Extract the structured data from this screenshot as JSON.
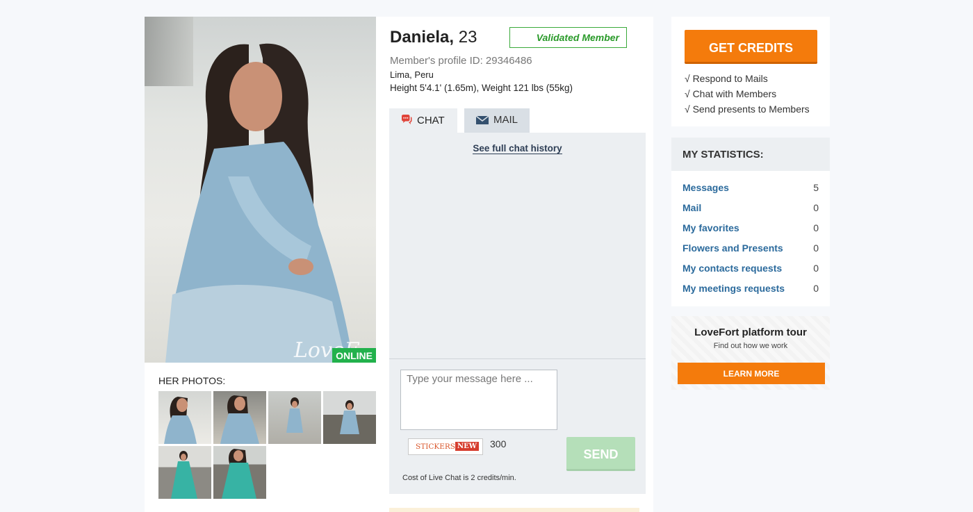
{
  "profile": {
    "name": "Daniela,",
    "age": "23",
    "validated_label": "Validated Member",
    "profile_id": "Member's profile ID: 29346486",
    "location": "Lima, Peru",
    "height_weight": "Height 5'4.1' (1.65m), Weight 121 lbs (55kg)",
    "online_label": "ONLINE",
    "watermark": "LoveF"
  },
  "photos": {
    "title": "HER PHOTOS:"
  },
  "tabs": {
    "chat_label": "CHAT",
    "mail_label": "MAIL"
  },
  "chat": {
    "history_link": "See full chat history",
    "placeholder": "Type your message here ...",
    "stickers_label": "STICKERS",
    "new_badge": "NEW",
    "char_count": "300",
    "send_label": "SEND",
    "cost_note": "Cost of Live Chat is 2 credits/min."
  },
  "credits": {
    "button_label": "GET CREDITS",
    "benefits": [
      "√ Respond to Mails",
      "√ Chat with Members",
      "√ Send presents to Members"
    ]
  },
  "statistics": {
    "title": "MY STATISTICS:",
    "rows": [
      {
        "label": "Messages",
        "value": "5"
      },
      {
        "label": "Mail",
        "value": "0"
      },
      {
        "label": "My favorites",
        "value": "0"
      },
      {
        "label": "Flowers and Presents",
        "value": "0"
      },
      {
        "label": "My contacts requests",
        "value": "0"
      },
      {
        "label": "My meetings requests",
        "value": "0"
      }
    ]
  },
  "tour": {
    "title": "LoveFort platform tour",
    "subtitle": "Find out how we work",
    "button_label": "LEARN MORE"
  },
  "colors": {
    "accent_orange": "#f47b0c",
    "online_green": "#22b14c",
    "link_blue": "#2b6a9c",
    "send_disabled": "#b5dfb9"
  }
}
